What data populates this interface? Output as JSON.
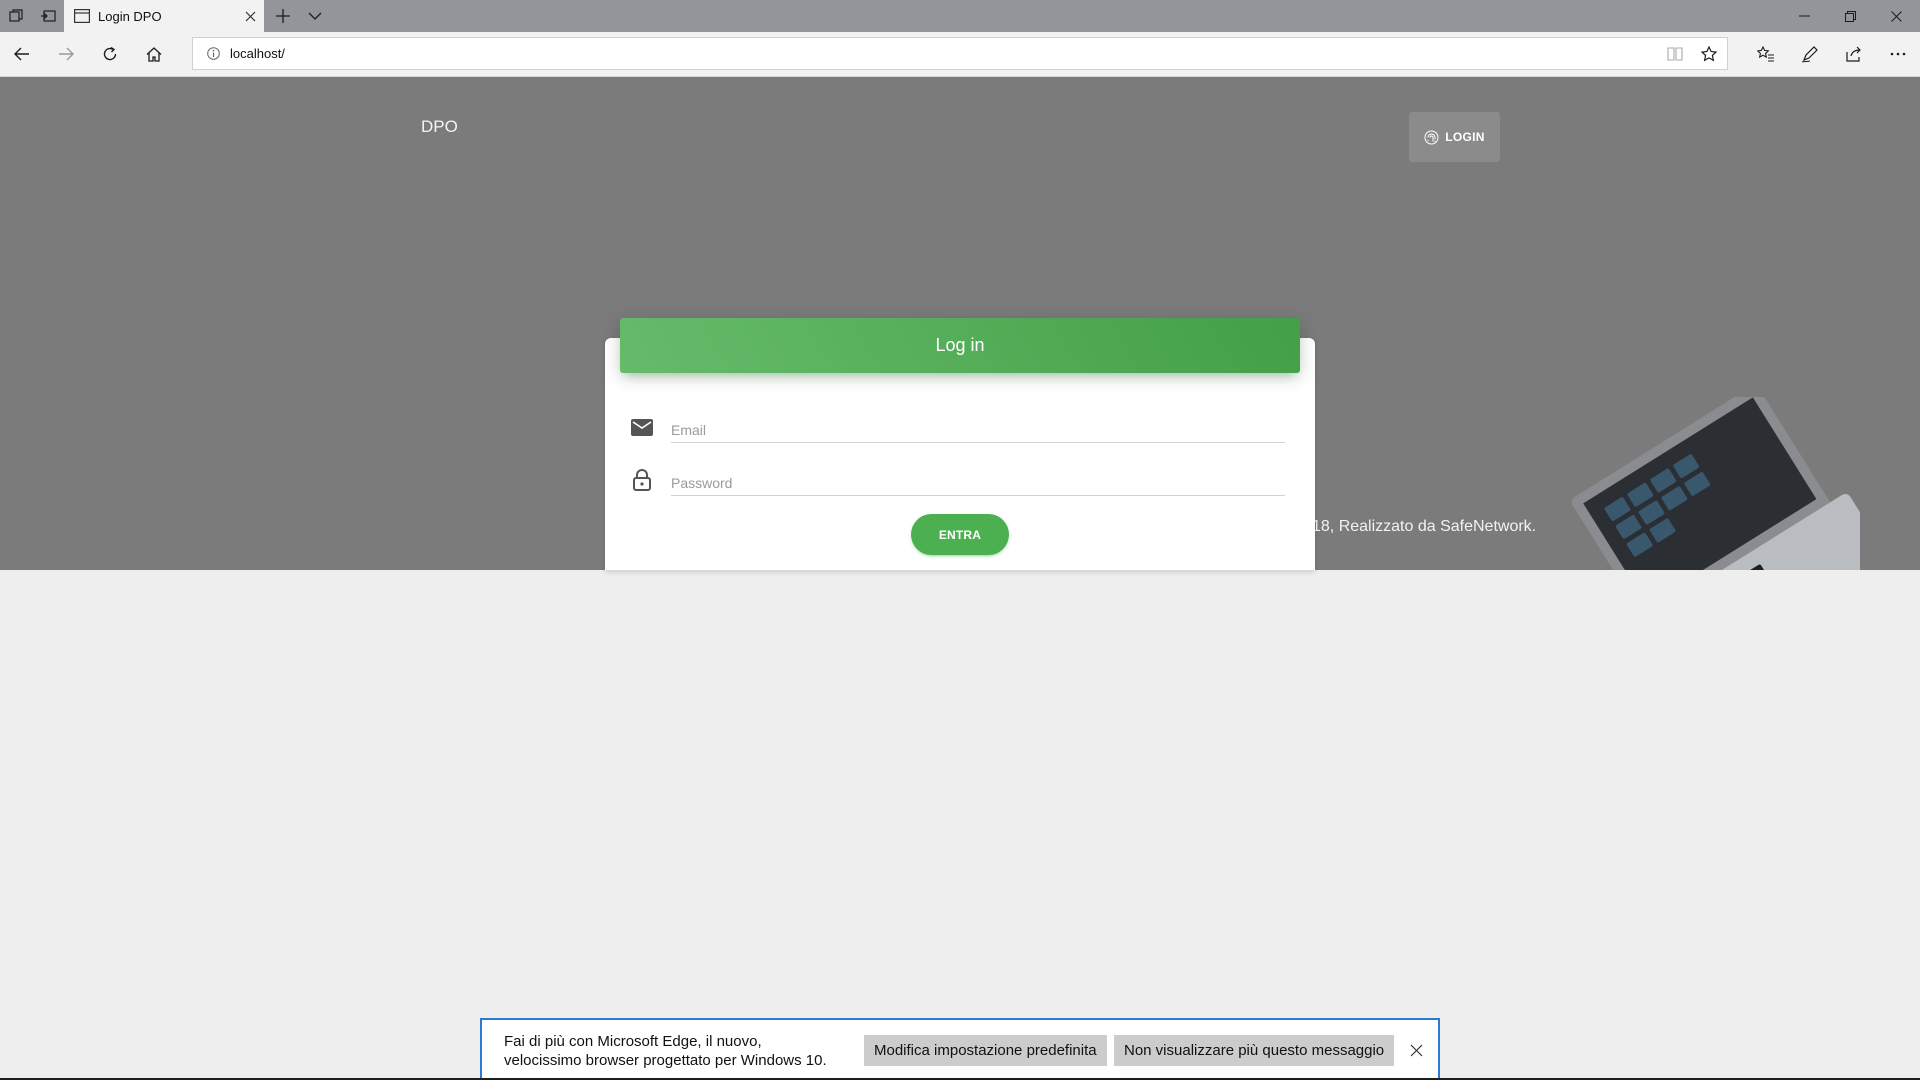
{
  "browser": {
    "tab_title": "Login DPO",
    "address": "localhost/",
    "icons": {
      "tab_manager": "tabs-aside-icon",
      "set_aside": "set-tabs-aside-icon",
      "page": "page-icon",
      "close_tab": "close-icon",
      "new_tab": "plus-icon",
      "tab_list": "chevron-down-icon",
      "minimize": "minimize-icon",
      "restore": "restore-icon",
      "close_window": "close-icon",
      "back": "back-arrow-icon",
      "forward": "forward-arrow-icon",
      "refresh": "refresh-icon",
      "home": "home-icon",
      "info": "info-icon",
      "reading_view": "reading-view-icon",
      "favorite": "star-icon",
      "favorites_hub": "favorites-list-icon",
      "notes": "pen-icon",
      "share": "share-icon",
      "more": "more-dots-icon"
    }
  },
  "page": {
    "brand": "DPO",
    "nav_login_label": "LOGIN",
    "footer_text": "18, Realizzato da SafeNetwork.",
    "card": {
      "title": "Log in",
      "email_placeholder": "Email",
      "password_placeholder": "Password",
      "submit_label": "ENTRA"
    },
    "colors": {
      "accent_green": "#4caf50",
      "hero_gray": "#7b7b7b"
    }
  },
  "notification": {
    "message_line1": "Fai di più con Microsoft Edge, il nuovo,",
    "message_line2": "velocissimo browser progettato per Windows 10.",
    "button_default": "Modifica impostazione predefinita",
    "button_dismiss": "Non visualizzare più questo messaggio",
    "accent": "#2c7ad6"
  }
}
